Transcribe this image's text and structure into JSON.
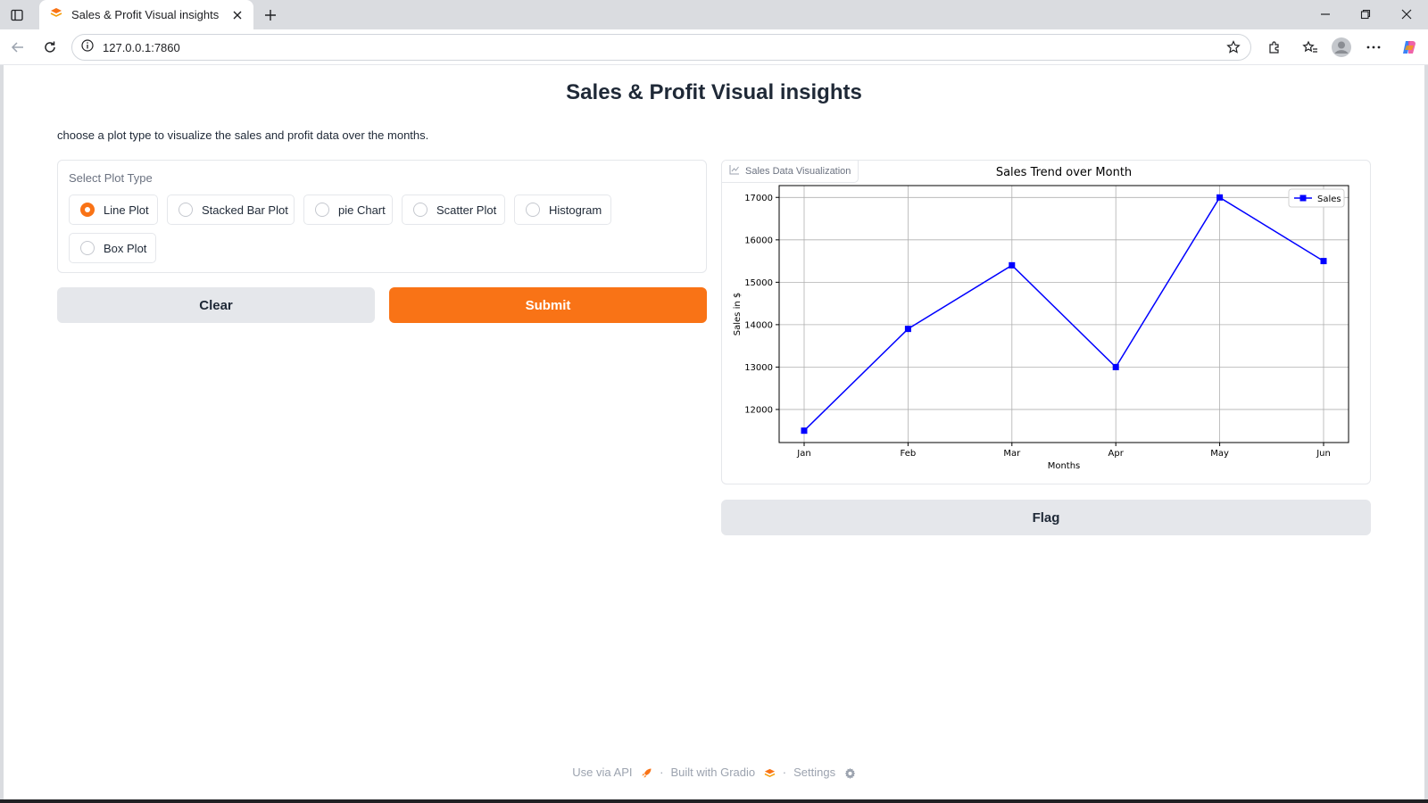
{
  "browser": {
    "tab_title": "Sales & Profit Visual insights",
    "url": "127.0.0.1:7860"
  },
  "page": {
    "title": "Sales & Profit Visual insights",
    "description": "choose a plot type to visualize the sales and profit data over the months."
  },
  "plot_type": {
    "label": "Select Plot Type",
    "options": [
      "Line Plot",
      "Stacked Bar Plot",
      "pie Chart",
      "Scatter Plot",
      "Histogram",
      "Box Plot"
    ],
    "selected": "Line Plot"
  },
  "buttons": {
    "clear": "Clear",
    "submit": "Submit",
    "flag": "Flag"
  },
  "output": {
    "label": "Sales Data Visualization"
  },
  "footer": {
    "api": "Use via API",
    "gradio": "Built with Gradio",
    "settings": "Settings",
    "separator": "·"
  },
  "colors": {
    "accent": "#f97316",
    "series": "#0000ff"
  },
  "chart_data": {
    "type": "line",
    "title": "Sales Trend over Month",
    "xlabel": "Months",
    "ylabel": "Sales in $",
    "categories": [
      "Jan",
      "Feb",
      "Mar",
      "Apr",
      "May",
      "Jun"
    ],
    "series": [
      {
        "name": "Sales",
        "values": [
          11500,
          13900,
          15400,
          13000,
          17000,
          15500
        ],
        "marker": "square"
      }
    ],
    "yticks": [
      12000,
      13000,
      14000,
      15000,
      16000,
      17000
    ],
    "ylim": [
      11220,
      17280
    ],
    "grid": true,
    "legend": "top-right"
  }
}
